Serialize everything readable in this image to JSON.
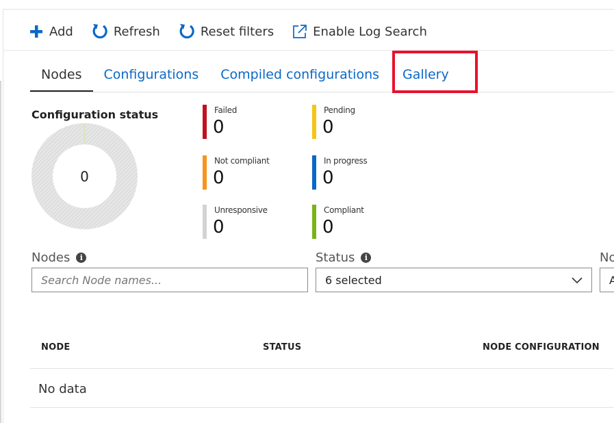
{
  "toolbar": {
    "add": "Add",
    "refresh": "Refresh",
    "reset_filters": "Reset filters",
    "enable_log_search": "Enable Log Search"
  },
  "tabs": [
    {
      "label": "Nodes",
      "active": true
    },
    {
      "label": "Configurations",
      "active": false
    },
    {
      "label": "Compiled configurations",
      "active": false
    },
    {
      "label": "Gallery",
      "active": false
    }
  ],
  "status_panel": {
    "title": "Configuration status",
    "total": "0",
    "stats": [
      {
        "label": "Failed",
        "value": "0",
        "color": "#c1121f"
      },
      {
        "label": "Pending",
        "value": "0",
        "color": "#f5c518"
      },
      {
        "label": "Not compliant",
        "value": "0",
        "color": "#f7941d"
      },
      {
        "label": "In progress",
        "value": "0",
        "color": "#0a68c7"
      },
      {
        "label": "Unresponsive",
        "value": "0",
        "color": "#d3d3d3"
      },
      {
        "label": "Compliant",
        "value": "0",
        "color": "#7ab317"
      }
    ]
  },
  "filters": {
    "nodes_label": "Nodes",
    "nodes_placeholder": "Search Node names...",
    "status_label": "Status",
    "status_value": "6 selected",
    "third_label_partial": "No",
    "third_value_partial": "A"
  },
  "table": {
    "headers": [
      "NODE",
      "STATUS",
      "NODE CONFIGURATION"
    ],
    "empty_text": "No data"
  },
  "colors": {
    "accent": "#0a68c7",
    "highlight": "#e8112d"
  }
}
